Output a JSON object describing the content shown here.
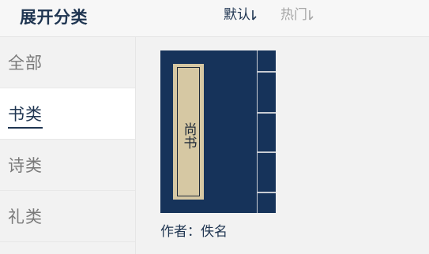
{
  "header": {
    "title": "展开分类",
    "sort_default_label": "默认",
    "sort_hot_label": "热门"
  },
  "sidebar": {
    "items": [
      {
        "label": "全部",
        "active": false
      },
      {
        "label": "书类",
        "active": true
      },
      {
        "label": "诗类",
        "active": false
      },
      {
        "label": "礼类",
        "active": false
      }
    ]
  },
  "books": [
    {
      "title": "尚书",
      "author": "作者：佚名"
    }
  ],
  "colors": {
    "primary": "#1f3551",
    "cover": "#16335a",
    "label_paper": "#d6c8a3",
    "inactive": "#a6a6a6"
  },
  "icons": {
    "sort_arrow": "sort-down-icon"
  }
}
